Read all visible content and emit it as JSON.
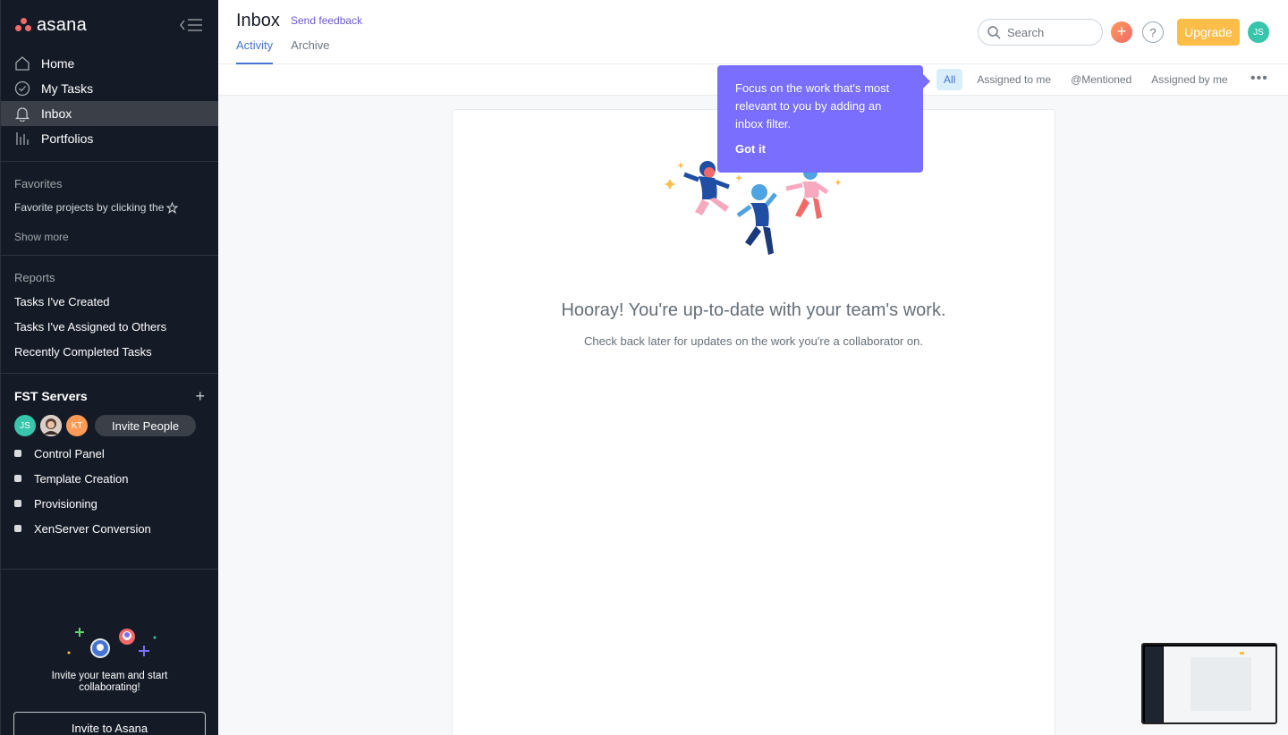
{
  "app": {
    "name": "asana",
    "colors": {
      "accent": "#4573d2",
      "brand_coral": "#f06a6a",
      "tooltip": "#796eff",
      "upgrade": "#fcbd49",
      "sidebar_bg": "#151b26"
    }
  },
  "sidebar": {
    "nav": [
      {
        "label": "Home",
        "icon": "home-icon"
      },
      {
        "label": "My Tasks",
        "icon": "check-circle-icon"
      },
      {
        "label": "Inbox",
        "icon": "bell-icon",
        "active": true
      },
      {
        "label": "Portfolios",
        "icon": "bar-chart-icon"
      }
    ],
    "favorites": {
      "title": "Favorites",
      "hint": "Favorite projects by clicking the",
      "show_more": "Show more"
    },
    "reports": {
      "title": "Reports",
      "items": [
        "Tasks I've Created",
        "Tasks I've Assigned to Others",
        "Recently Completed Tasks"
      ]
    },
    "team": {
      "name": "FST Servers",
      "members": [
        {
          "initials": "JS",
          "color": "#37c5ab"
        },
        {
          "initials": "",
          "color": "#8d6e63"
        },
        {
          "initials": "KT",
          "color": "#fd9a56"
        }
      ],
      "invite_label": "Invite People",
      "projects": [
        "Control Panel",
        "Template Creation",
        "Provisioning",
        "XenServer Conversion"
      ]
    },
    "invite_promo": {
      "text": "Invite your team and start collaborating!",
      "button": "Invite to Asana"
    }
  },
  "header": {
    "title": "Inbox",
    "feedback_link": "Send feedback",
    "tabs": [
      {
        "label": "Activity",
        "active": true
      },
      {
        "label": "Archive",
        "active": false
      }
    ],
    "search_placeholder": "Search",
    "add_symbol": "+",
    "help_symbol": "?",
    "upgrade_label": "Upgrade",
    "user_initials": "JS"
  },
  "filters": {
    "items": [
      {
        "label": "All",
        "active": true
      },
      {
        "label": "Assigned to me",
        "active": false
      },
      {
        "label": "@Mentioned",
        "active": false
      },
      {
        "label": "Assigned by me",
        "active": false
      }
    ],
    "more_symbol": "•••"
  },
  "tooltip": {
    "text": "Focus on the work that's most relevant to you by adding an inbox filter.",
    "button": "Got it"
  },
  "empty_state": {
    "heading": "Hooray! You're up-to-date with your team's work.",
    "subtext": "Check back later for updates on the work you're a collaborator on."
  }
}
